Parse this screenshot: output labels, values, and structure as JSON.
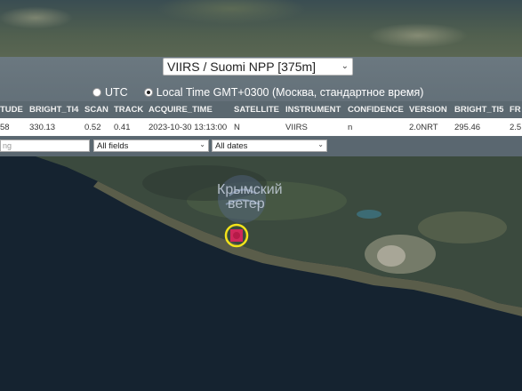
{
  "satellite_select": {
    "value": "VIIRS / Suomi NPP [375m]"
  },
  "timezone": {
    "utc_label": "UTC",
    "local_label": "Local Time GMT+0300 (Москва, стандартное время)",
    "selected": "local"
  },
  "table": {
    "columns": [
      "TUDE",
      "BRIGHT_TI4",
      "SCAN",
      "TRACK",
      "ACQUIRE_TIME",
      "SATELLITE",
      "INSTRUMENT",
      "CONFIDENCE",
      "VERSION",
      "BRIGHT_TI5",
      "FR"
    ],
    "rows": [
      [
        "58",
        "330.13",
        "0.52",
        "0.41",
        "2023-10-30 13:13:00",
        "N",
        "VIIRS",
        "n",
        "2.0NRT",
        "295.46",
        "2.5"
      ]
    ]
  },
  "filters": {
    "search_placeholder": "ng",
    "fields_select": "All fields",
    "dates_select": "All dates"
  },
  "watermark": {
    "line1": "Крымский",
    "line2": "ветер"
  },
  "colors": {
    "panel": "#5b6870",
    "fire_marker": "#e0245e",
    "marker_ring": "#f2e21a"
  }
}
